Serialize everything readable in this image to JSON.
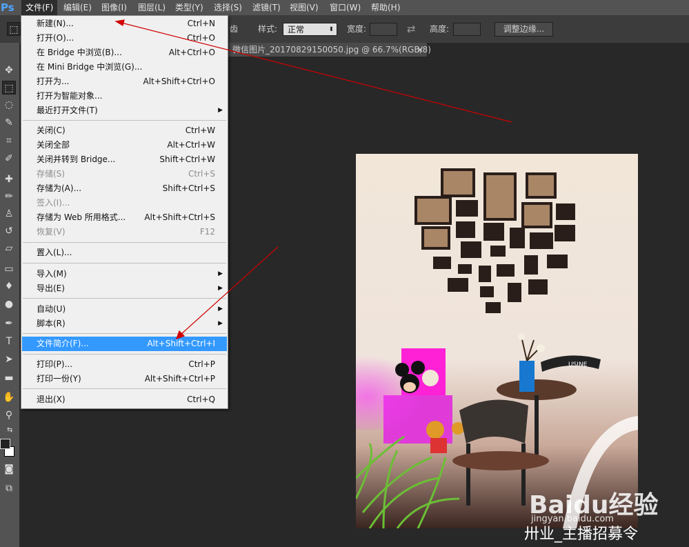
{
  "app": {
    "logo": "Ps"
  },
  "menubar": [
    {
      "label": "文件(F)",
      "active": true
    },
    {
      "label": "编辑(E)"
    },
    {
      "label": "图像(I)"
    },
    {
      "label": "图层(L)"
    },
    {
      "label": "类型(Y)"
    },
    {
      "label": "选择(S)"
    },
    {
      "label": "滤镜(T)"
    },
    {
      "label": "视图(V)"
    },
    {
      "label": "窗口(W)"
    },
    {
      "label": "帮助(H)"
    }
  ],
  "options": {
    "feather_partial": "齿",
    "style_label": "样式:",
    "style_value": "正常",
    "width_label": "宽度:",
    "height_label": "高度:",
    "refine_button": "调整边缘..."
  },
  "document_tab": {
    "title": "微信图片_20170829150050.jpg @ 66.7%(RGB/8)",
    "close": "×"
  },
  "file_menu": [
    {
      "label": "新建(N)...",
      "shortcut": "Ctrl+N"
    },
    {
      "label": "打开(O)...",
      "shortcut": "Ctrl+O"
    },
    {
      "label": "在 Bridge 中浏览(B)...",
      "shortcut": "Alt+Ctrl+O"
    },
    {
      "label": "在 Mini Bridge 中浏览(G)...",
      "shortcut": ""
    },
    {
      "label": "打开为...",
      "shortcut": "Alt+Shift+Ctrl+O"
    },
    {
      "label": "打开为智能对象...",
      "shortcut": ""
    },
    {
      "label": "最近打开文件(T)",
      "shortcut": "",
      "submenu": true
    },
    {
      "label": "关闭(C)",
      "shortcut": "Ctrl+W"
    },
    {
      "label": "关闭全部",
      "shortcut": "Alt+Ctrl+W"
    },
    {
      "label": "关闭并转到 Bridge...",
      "shortcut": "Shift+Ctrl+W"
    },
    {
      "label": "存储(S)",
      "shortcut": "Ctrl+S",
      "disabled": true
    },
    {
      "label": "存储为(A)...",
      "shortcut": "Shift+Ctrl+S"
    },
    {
      "label": "签入(I)...",
      "shortcut": "",
      "disabled": true
    },
    {
      "label": "存储为 Web 所用格式...",
      "shortcut": "Alt+Shift+Ctrl+S"
    },
    {
      "label": "恢复(V)",
      "shortcut": "F12",
      "disabled": true
    },
    {
      "label": "置入(L)...",
      "shortcut": ""
    },
    {
      "label": "导入(M)",
      "shortcut": "",
      "submenu": true
    },
    {
      "label": "导出(E)",
      "shortcut": "",
      "submenu": true
    },
    {
      "label": "自动(U)",
      "shortcut": "",
      "submenu": true
    },
    {
      "label": "脚本(R)",
      "shortcut": "",
      "submenu": true
    },
    {
      "label": "文件简介(F)...",
      "shortcut": "Alt+Shift+Ctrl+I",
      "highlighted": true
    },
    {
      "label": "打印(P)...",
      "shortcut": "Ctrl+P"
    },
    {
      "label": "打印一份(Y)",
      "shortcut": "Alt+Shift+Ctrl+P"
    },
    {
      "label": "退出(X)",
      "shortcut": "Ctrl+Q"
    }
  ],
  "photo": {
    "chair_text": "USINE"
  },
  "watermark": {
    "baidu": "Baidu经验",
    "site": "jingyan.baidu.com",
    "weibo": "卅业_主播招募令"
  },
  "colors": {
    "accent": "#3399ff",
    "annotation": "#d10000"
  }
}
